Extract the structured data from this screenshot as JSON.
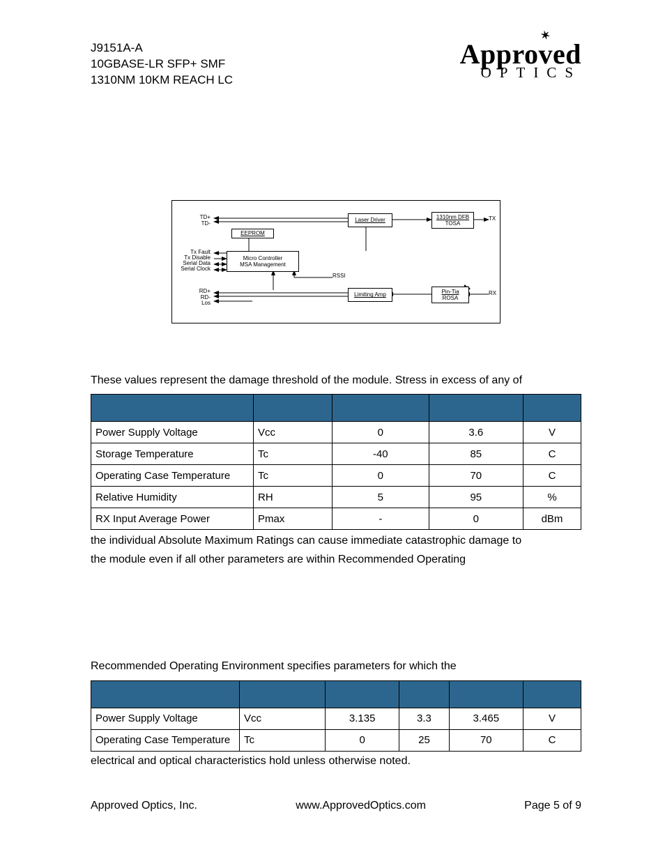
{
  "header": {
    "line1": "J9151A-A",
    "line2": "10GBASE-LR SFP+ SMF",
    "line3": "1310NM 10KM REACH LC",
    "logo_top": "Appro",
    "logo_v": "v",
    "logo_ed": "ed",
    "logo_sub": "OPTICS"
  },
  "diagram": {
    "labels": {
      "td": "TD+\nTD-",
      "txfault": "Tx Fault",
      "txdisable": "Tx Disable",
      "serialdata": "Serial Data",
      "serialclock": "Serial Clock",
      "rd": "RD+\nRD-\nLos",
      "tx": "TX",
      "rx": "RX",
      "rssi": "RSSI"
    },
    "boxes": {
      "eeprom": "EEPROM",
      "micro_l1": "Micro Controller",
      "micro_l2": "MSA Management",
      "laserdriver": "Laser Driver",
      "tosa_l1": "1310nm DFB",
      "tosa_l2": "TOSA",
      "limitingamp": "Limiting Amp",
      "rosa_l1": "Pin-Tia",
      "rosa_l2": "ROSA"
    }
  },
  "para1": "These values represent the damage threshold of the module. Stress in excess of any of",
  "table1": {
    "rows": [
      {
        "p": "Power Supply Voltage",
        "s": "Vcc",
        "min": "0",
        "max": "3.6",
        "u": "V"
      },
      {
        "p": "Storage Temperature",
        "s": "Tc",
        "min": "-40",
        "max": "85",
        "u": "C"
      },
      {
        "p": "Operating Case Temperature",
        "s": "Tc",
        "min": "0",
        "max": "70",
        "u": "C"
      },
      {
        "p": "Relative Humidity",
        "s": "RH",
        "min": "5",
        "max": "95",
        "u": "%"
      },
      {
        "p": "RX Input Average Power",
        "s": "Pmax",
        "min": "-",
        "max": "0",
        "u": "dBm"
      }
    ]
  },
  "para2a": "the individual Absolute Maximum Ratings can cause immediate catastrophic damage to",
  "para2b": "the module even if all other parameters are within Recommended Operating",
  "para3": "Recommended Operating Environment specifies parameters for which the",
  "table2": {
    "rows": [
      {
        "p": "Power Supply Voltage",
        "s": "Vcc",
        "min": "3.135",
        "typ": "3.3",
        "max": "3.465",
        "u": "V"
      },
      {
        "p": "Operating Case Temperature",
        "s": "Tc",
        "min": "0",
        "typ": "25",
        "max": "70",
        "u": "C"
      }
    ]
  },
  "para4": "electrical and optical characteristics hold unless otherwise noted.",
  "footer": {
    "company": "Approved Optics, Inc.",
    "url": "www.ApprovedOptics.com",
    "page": "Page 5 of 9"
  }
}
